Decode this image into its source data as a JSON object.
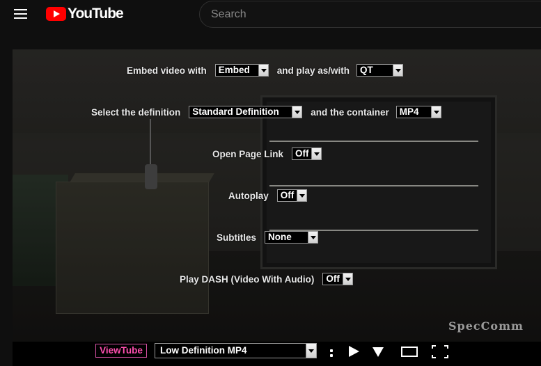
{
  "header": {
    "logo_text": "YouTube",
    "search_placeholder": "Search"
  },
  "settings": {
    "embed": {
      "label": "Embed video with",
      "value": "Embed",
      "label2": "and play as/with",
      "value2": "QT"
    },
    "definition": {
      "label": "Select the definition",
      "value": "Standard Definition",
      "label2": "and the container",
      "value2": "MP4"
    },
    "open_page_link": {
      "label": "Open Page Link",
      "value": "Off"
    },
    "autoplay": {
      "label": "Autoplay",
      "value": "Off"
    },
    "subtitles": {
      "label": "Subtitles",
      "value": "None"
    },
    "dash": {
      "label": "Play DASH (Video With Audio)",
      "value": "Off"
    }
  },
  "video": {
    "watermark": "SpecComm"
  },
  "controls": {
    "viewtube_label": "ViewTube",
    "quality_value": "Low Definition MP4",
    "icons": [
      "menu-colon-icon",
      "play-icon",
      "download-icon",
      "theater-icon",
      "fullscreen-icon"
    ]
  },
  "colors": {
    "logo_red": "#ff0000",
    "viewtube_pink": "#ff4fb0",
    "page_bg": "#0f0f0f"
  }
}
